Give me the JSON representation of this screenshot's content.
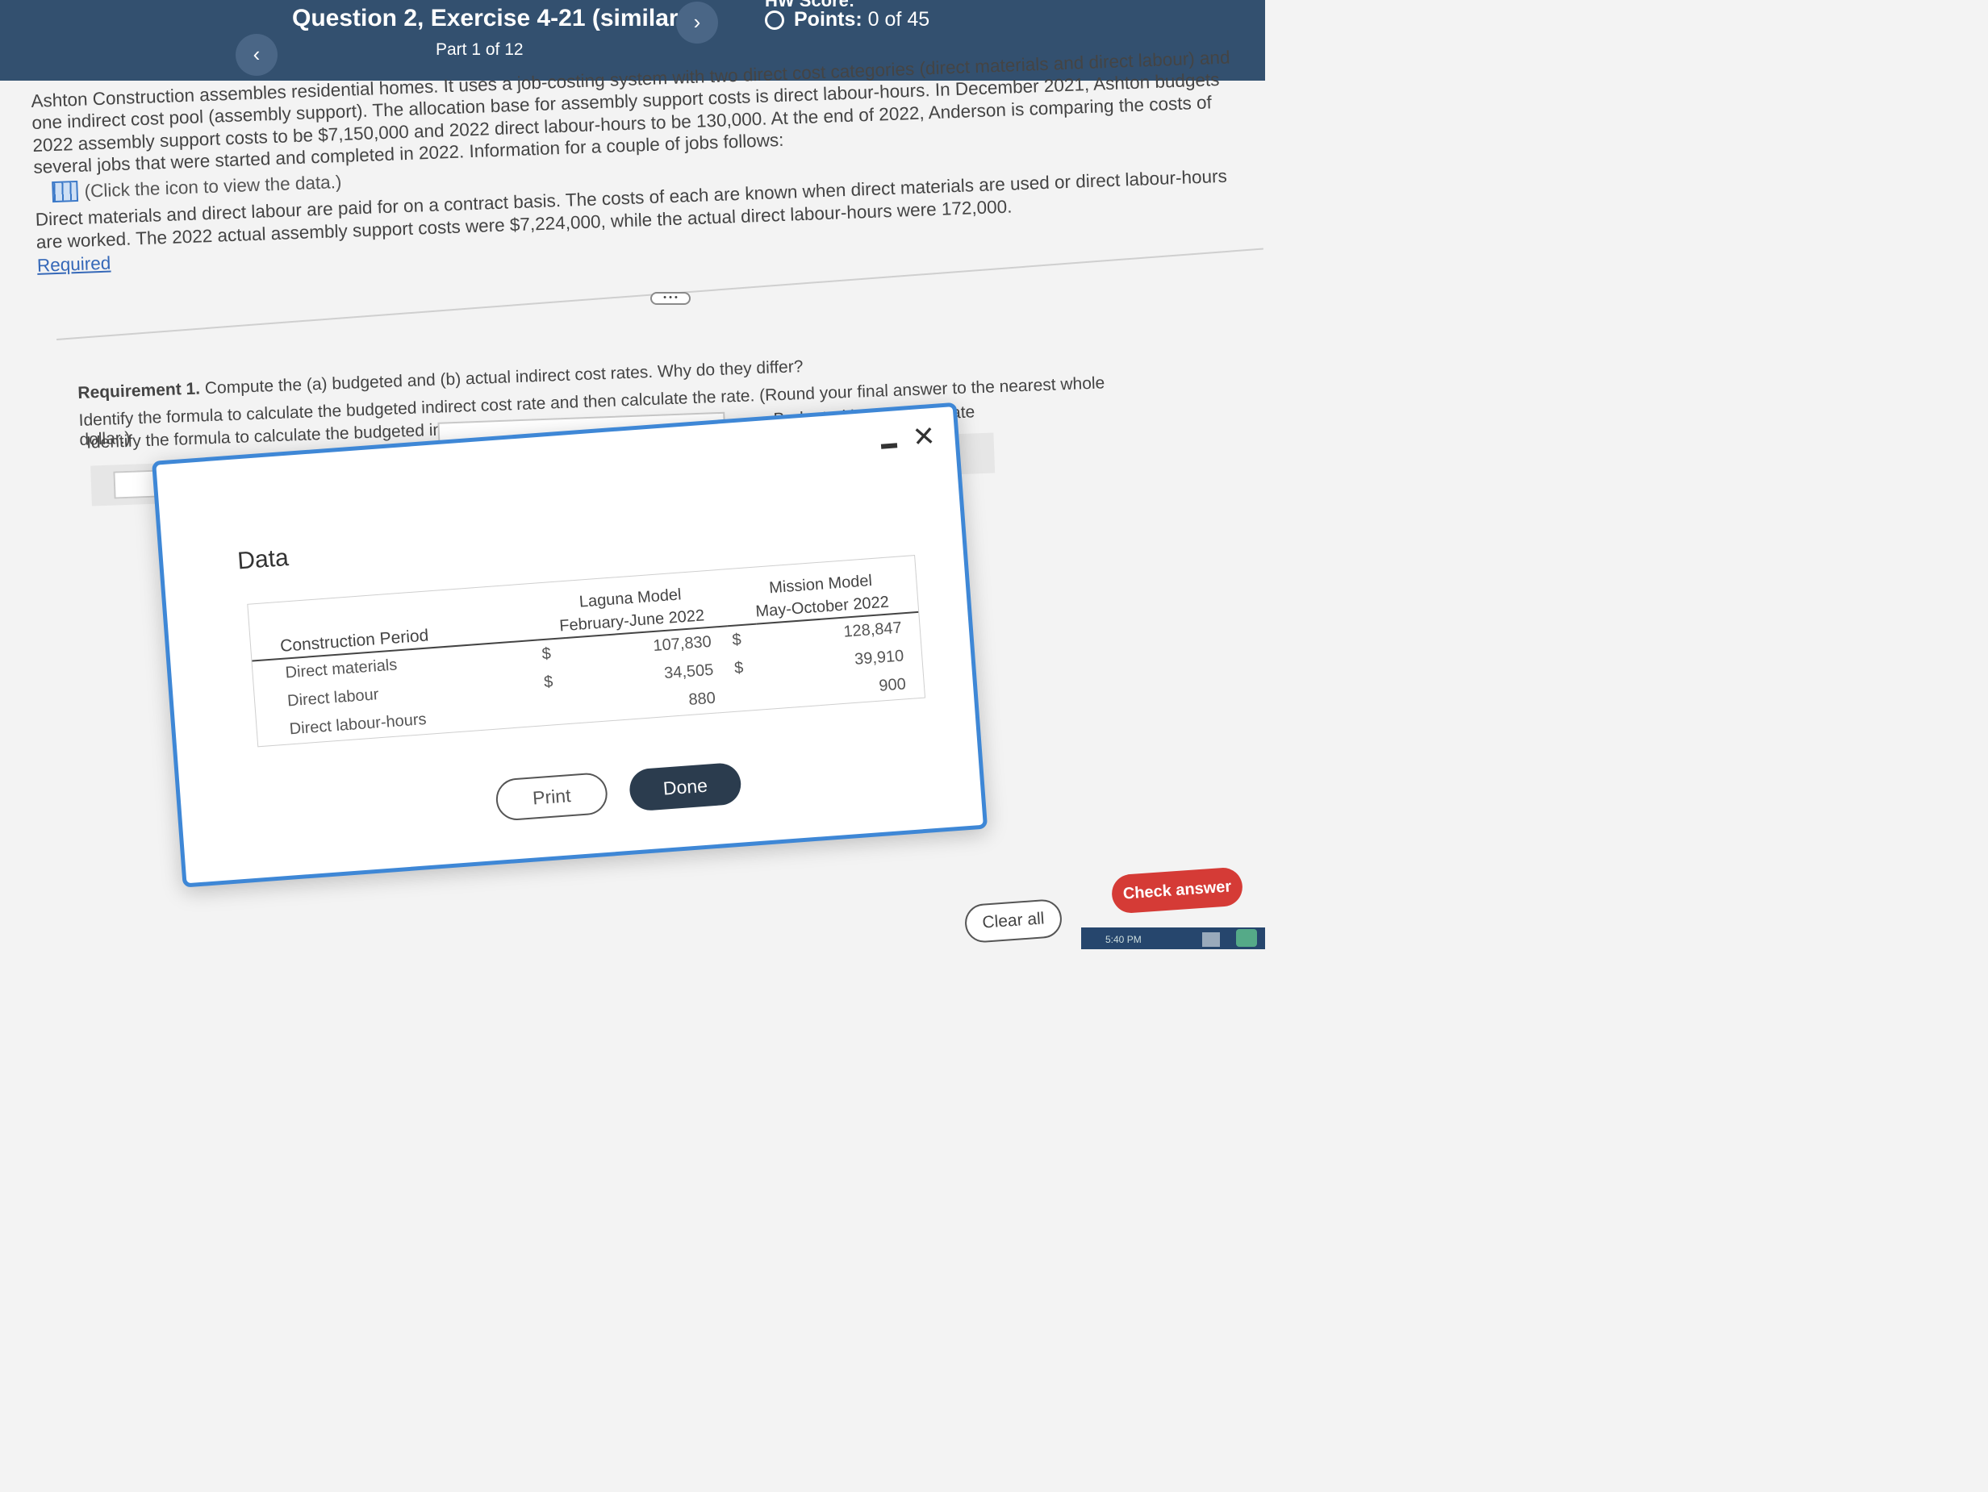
{
  "header": {
    "prev_icon": "chevron-left-icon",
    "prev_glyph": "‹",
    "next_icon": "chevron-right-icon",
    "next_glyph": "›",
    "title": "Question 2, Exercise 4-21 (similar to)",
    "part": "Part 1 of 12",
    "hw_score": "HW Score:",
    "points_label": "Points:",
    "points_value": "0 of 45",
    "colors": {
      "bar": "#33506f",
      "button": "#4a6686"
    }
  },
  "problem": {
    "paragraph": "Ashton Construction assembles residential homes. It uses a job-costing system with two direct cost categories (direct materials and direct labour) and one indirect cost pool (assembly support). The allocation base for assembly support costs is direct labour-hours. In December 2021, Ashton budgets 2022 assembly support costs to be $7,150,000 and 2022 direct labour-hours to be 130,000. At the end of 2022, Anderson is comparing the costs of several jobs that were started and completed in 2022. Information for a couple of jobs follows:",
    "data_link": "(Click the icon to view the data.)",
    "data_icon": "table-icon",
    "paragraph2": "Direct materials and direct labour are paid for on a contract basis. The costs of each are known when direct materials are used or direct labour-hours are worked. The 2022 actual assembly support costs were $7,224,000, while the actual direct labour-hours were 172,000.",
    "required_link": "Required",
    "more_label": "• • •"
  },
  "requirement": {
    "label": "Requirement 1.",
    "text": "Compute the (a) budgeted and (b) actual indirect cost rates. Why do they differ?",
    "instruction": "Identify the formula to calculate the budgeted indirect cost rate and then calculate the rate. (Round your final answer to the nearest whole dollar.)",
    "formula_label": "Identify the formula to calculate the budgeted indirect cost rate",
    "divide_symbol": "/",
    "equals_symbol": "=",
    "result_label": "Budgeted indirect cost rate"
  },
  "modal": {
    "title": "Data",
    "minimize_icon": "minimize-icon",
    "close_icon": "close-icon",
    "close_glyph": "✕",
    "table": {
      "row_header": "Construction Period",
      "columns": [
        {
          "model": "Laguna Model",
          "period": "February-June 2022"
        },
        {
          "model": "Mission Model",
          "period": "May-October 2022"
        }
      ],
      "rows": [
        {
          "label": "Direct materials",
          "dollar": "$",
          "laguna": "107,830",
          "mission": "128,847"
        },
        {
          "label": "Direct labour",
          "dollar": "$",
          "laguna": "34,505",
          "mission": "39,910"
        },
        {
          "label": "Direct labour-hours",
          "dollar": "",
          "laguna": "880",
          "mission": "900"
        }
      ]
    },
    "print_label": "Print",
    "done_label": "Done",
    "border_color": "#3e87d6"
  },
  "footer": {
    "clear_all": "Clear all",
    "check_answer": "Check answer",
    "check_color": "#d53b36",
    "clock": "5:40 PM"
  }
}
